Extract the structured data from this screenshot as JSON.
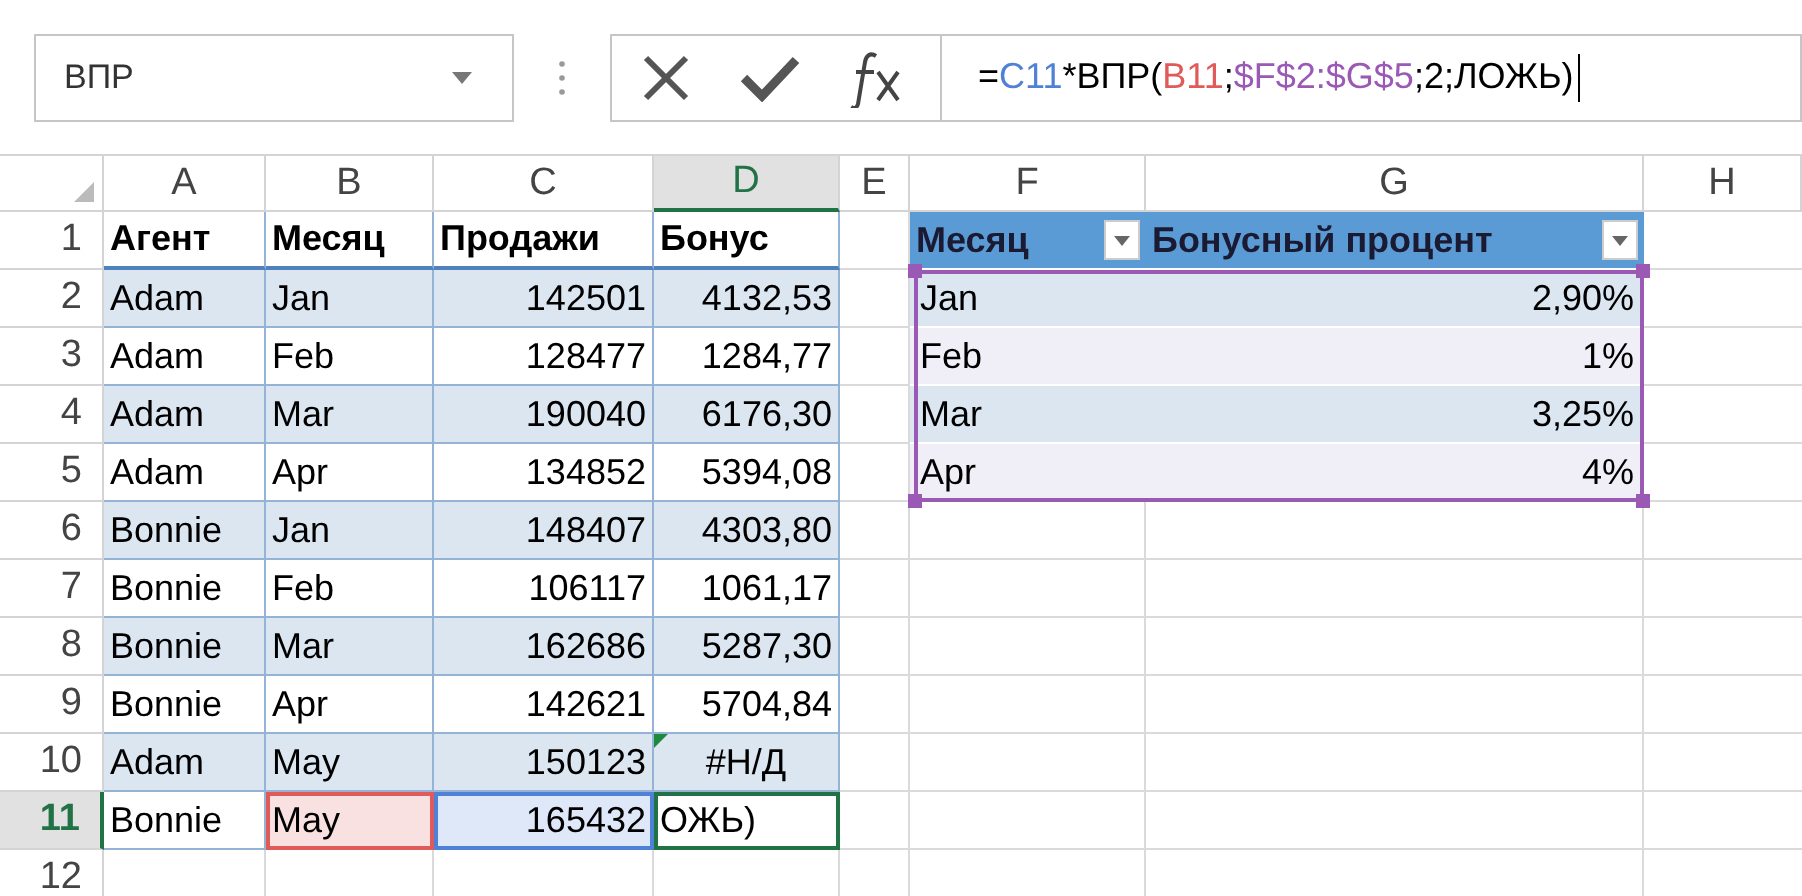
{
  "name_box": {
    "value": "ВПР"
  },
  "formula_bar": {
    "segments": [
      {
        "text": "=",
        "color": "#000000"
      },
      {
        "text": "C11",
        "color": "#4f81d6"
      },
      {
        "text": "*ВПР(",
        "color": "#000000"
      },
      {
        "text": "B11",
        "color": "#e05a5a"
      },
      {
        "text": ";",
        "color": "#000000"
      },
      {
        "text": "$F$2:$G$5",
        "color": "#9b59b6"
      },
      {
        "text": ";2;ЛОЖЬ)",
        "color": "#000000"
      }
    ]
  },
  "column_headers": [
    {
      "label": "A",
      "selected": false
    },
    {
      "label": "B",
      "selected": false
    },
    {
      "label": "C",
      "selected": false
    },
    {
      "label": "D",
      "selected": true
    },
    {
      "label": "E",
      "selected": false
    },
    {
      "label": "F",
      "selected": false
    },
    {
      "label": "G",
      "selected": false
    },
    {
      "label": "H",
      "selected": false
    }
  ],
  "row_numbers": [
    {
      "label": "1",
      "selected": false
    },
    {
      "label": "2",
      "selected": false
    },
    {
      "label": "3",
      "selected": false
    },
    {
      "label": "4",
      "selected": false
    },
    {
      "label": "5",
      "selected": false
    },
    {
      "label": "6",
      "selected": false
    },
    {
      "label": "7",
      "selected": false
    },
    {
      "label": "8",
      "selected": false
    },
    {
      "label": "9",
      "selected": false
    },
    {
      "label": "10",
      "selected": false
    },
    {
      "label": "11",
      "selected": true
    },
    {
      "label": "12",
      "selected": false
    }
  ],
  "data_table": {
    "rows": [
      {
        "cells": [
          {
            "text": "Агент",
            "kind": "header"
          },
          {
            "text": "Месяц",
            "kind": "header"
          },
          {
            "text": "Продажи",
            "kind": "header"
          },
          {
            "text": "Бонус",
            "kind": "header"
          }
        ]
      },
      {
        "cells": [
          {
            "text": "Adam",
            "kind": "text"
          },
          {
            "text": "Jan",
            "kind": "text"
          },
          {
            "text": "142501",
            "kind": "number"
          },
          {
            "text": "4132,53",
            "kind": "number"
          }
        ]
      },
      {
        "cells": [
          {
            "text": "Adam",
            "kind": "text"
          },
          {
            "text": "Feb",
            "kind": "text"
          },
          {
            "text": "128477",
            "kind": "number"
          },
          {
            "text": "1284,77",
            "kind": "number"
          }
        ]
      },
      {
        "cells": [
          {
            "text": "Adam",
            "kind": "text"
          },
          {
            "text": "Mar",
            "kind": "text"
          },
          {
            "text": "190040",
            "kind": "number"
          },
          {
            "text": "6176,30",
            "kind": "number"
          }
        ]
      },
      {
        "cells": [
          {
            "text": "Adam",
            "kind": "text"
          },
          {
            "text": "Apr",
            "kind": "text"
          },
          {
            "text": "134852",
            "kind": "number"
          },
          {
            "text": "5394,08",
            "kind": "number"
          }
        ]
      },
      {
        "cells": [
          {
            "text": "Bonnie",
            "kind": "text"
          },
          {
            "text": "Jan",
            "kind": "text"
          },
          {
            "text": "148407",
            "kind": "number"
          },
          {
            "text": "4303,80",
            "kind": "number"
          }
        ]
      },
      {
        "cells": [
          {
            "text": "Bonnie",
            "kind": "text"
          },
          {
            "text": "Feb",
            "kind": "text"
          },
          {
            "text": "106117",
            "kind": "number"
          },
          {
            "text": "1061,17",
            "kind": "number"
          }
        ]
      },
      {
        "cells": [
          {
            "text": "Bonnie",
            "kind": "text"
          },
          {
            "text": "Mar",
            "kind": "text"
          },
          {
            "text": "162686",
            "kind": "number"
          },
          {
            "text": "5287,30",
            "kind": "number"
          }
        ]
      },
      {
        "cells": [
          {
            "text": "Bonnie",
            "kind": "text"
          },
          {
            "text": "Apr",
            "kind": "text"
          },
          {
            "text": "142621",
            "kind": "number"
          },
          {
            "text": "5704,84",
            "kind": "number"
          }
        ]
      },
      {
        "cells": [
          {
            "text": "Adam",
            "kind": "text"
          },
          {
            "text": "May",
            "kind": "text"
          },
          {
            "text": "150123",
            "kind": "number"
          },
          {
            "text": "#Н/Д",
            "kind": "error",
            "error_flag": true
          }
        ]
      },
      {
        "cells": [
          {
            "text": "Bonnie",
            "kind": "text"
          },
          {
            "text": "May",
            "kind": "text",
            "color": "#e05a5a"
          },
          {
            "text": "165432",
            "kind": "number",
            "color": "#4f81d6"
          },
          {
            "text": "ОЖЬ)",
            "kind": "editing",
            "color": "#217346"
          }
        ]
      }
    ]
  },
  "lookup_table": {
    "color": "#9b59b6",
    "headers": [
      "Месяц",
      "Бонусный процент"
    ],
    "rows": [
      {
        "cells": [
          "Jan",
          "2,90%"
        ]
      },
      {
        "cells": [
          "Feb",
          "1%"
        ]
      },
      {
        "cells": [
          "Mar",
          "3,25%"
        ]
      },
      {
        "cells": [
          "Apr",
          "4%"
        ]
      }
    ]
  }
}
